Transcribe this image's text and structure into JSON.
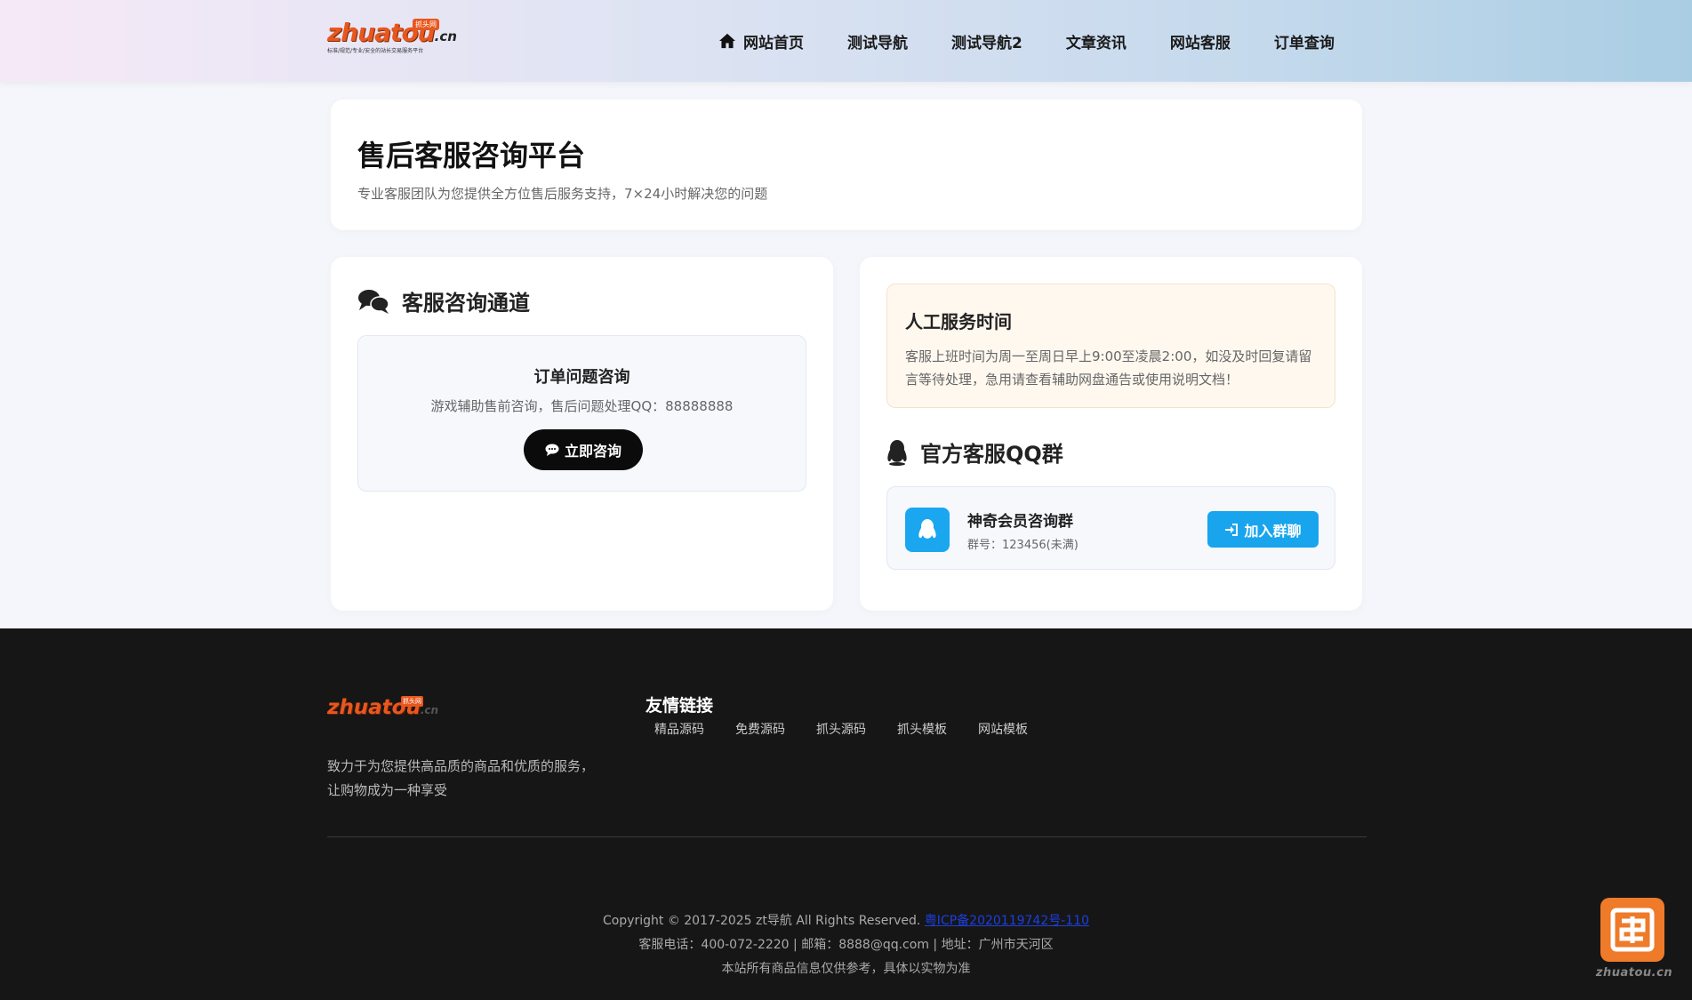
{
  "header": {
    "logo": {
      "word": "zhuatou",
      "suffix": ".cn",
      "badge": "抓头网",
      "tagline": "标准/规范/专业/安全的站长交易服务平台"
    },
    "nav": [
      {
        "label": "网站首页",
        "icon": "home-icon"
      },
      {
        "label": "测试导航"
      },
      {
        "label": "测试导航2"
      },
      {
        "label": "文章资讯"
      },
      {
        "label": "网站客服"
      },
      {
        "label": "订单查询"
      }
    ]
  },
  "hero": {
    "title": "售后客服咨询平台",
    "subtitle": "专业客服团队为您提供全方位售后服务支持，7×24小时解决您的问题"
  },
  "consult": {
    "section_title": "客服咨询通道",
    "box_title": "订单问题咨询",
    "box_desc": "游戏辅助售前咨询，售后问题处理QQ：88888888",
    "button": "立即咨询"
  },
  "service": {
    "title": "人工服务时间",
    "desc": "客服上班时间为周一至周日早上9:00至凌晨2:00，如没及时回复请留言等待处理，急用请查看辅助网盘通告或使用说明文档！"
  },
  "qq_group": {
    "section_title": "官方客服QQ群",
    "name": "神奇会员咨询群",
    "number": "群号：123456(未满)",
    "button": "加入群聊"
  },
  "footer": {
    "logo": {
      "word": "zhuatou",
      "suffix": ".cn",
      "badge": "抓头网"
    },
    "desc": "致力于为您提供高品质的商品和优质的服务，让购物成为一种享受",
    "links_title": "友情链接",
    "links": [
      "精品源码",
      "免费源码",
      "抓头源码",
      "抓头模板",
      "网站模板"
    ],
    "copyright": "Copyright © 2017-2025 zt导航 All Rights Reserved.",
    "icp": "粤ICP备2020119742号-110",
    "contact": "客服电话：400-072-2220 | 邮箱：8888@qq.com | 地址：广州市天河区",
    "disclaimer": "本站所有商品信息仅供参考，具体以实物为准"
  },
  "float_widget": {
    "label": "zhuatou.cn"
  },
  "colors": {
    "accent_orange": "#e8571e",
    "qq_blue": "#18a5ee",
    "dark": "#161616"
  }
}
